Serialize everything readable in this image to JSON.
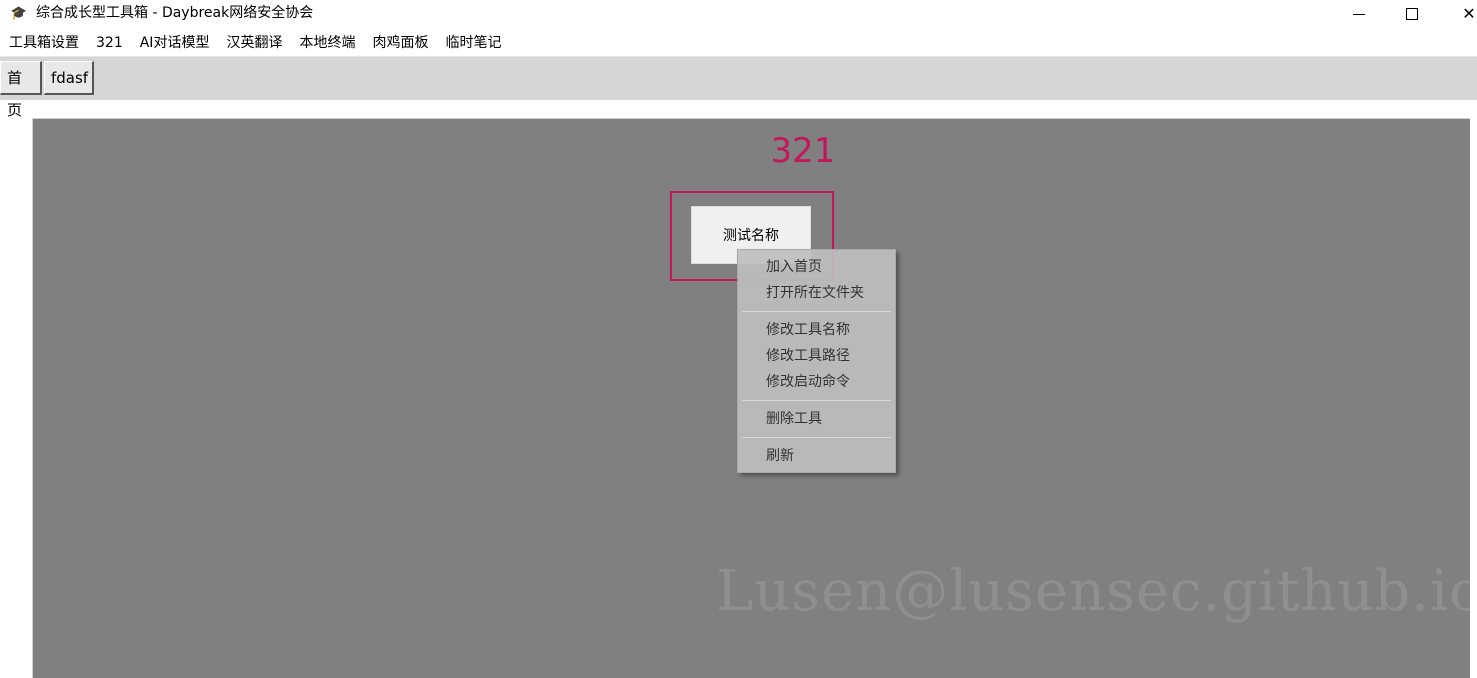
{
  "window": {
    "title": "综合成长型工具箱 - Daybreak网络安全协会",
    "icon": "hat-icon",
    "minimize": "—",
    "close": "✕"
  },
  "menubar": {
    "items": [
      {
        "label": "工具箱设置"
      },
      {
        "label": "321"
      },
      {
        "label": "AI对话模型"
      },
      {
        "label": "汉英翻译"
      },
      {
        "label": "本地终端"
      },
      {
        "label": "肉鸡面板"
      },
      {
        "label": "临时笔记"
      }
    ]
  },
  "tabs": [
    {
      "label": "首页"
    },
    {
      "label": "fdasf"
    }
  ],
  "content": {
    "section_title": "321",
    "tool_button_label": "测试名称",
    "watermark": "Lusen@lusensec.github.io",
    "colors": {
      "background": "#808080",
      "accent": "#c2185b"
    }
  },
  "context_menu": {
    "group1": [
      "加入首页",
      "打开所在文件夹"
    ],
    "group2": [
      "修改工具名称",
      "修改工具路径",
      "修改启动命令"
    ],
    "group3": [
      "删除工具"
    ],
    "group4": [
      "刷新"
    ]
  }
}
